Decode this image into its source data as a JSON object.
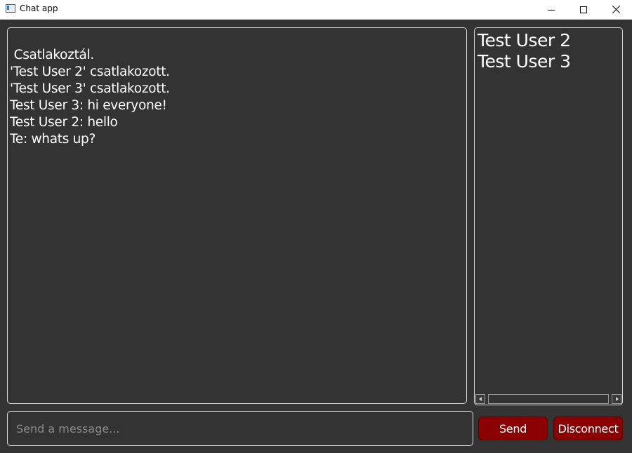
{
  "window": {
    "title": "Chat app",
    "icon": "app-window-icon",
    "controls": [
      "minimize-icon",
      "maximize-icon",
      "close-icon"
    ]
  },
  "chat": {
    "messages": [
      " Csatlakoztál.",
      "'Test User 2' csatlakozott.",
      "'Test User 3' csatlakozott.",
      "Test User 3: hi everyone!",
      "Test User 2: hello",
      "Te: whats up?"
    ]
  },
  "users": {
    "items": [
      "Test User 2",
      "Test User 3"
    ]
  },
  "composer": {
    "placeholder": "Send a message...",
    "value": ""
  },
  "buttons": {
    "send_label": "Send",
    "disconnect_label": "Disconnect"
  },
  "colors": {
    "background": "#333333",
    "border": "#dcdcdc",
    "button": "#8b0000",
    "text": "#ffffff",
    "placeholder": "#8a8a8a"
  }
}
